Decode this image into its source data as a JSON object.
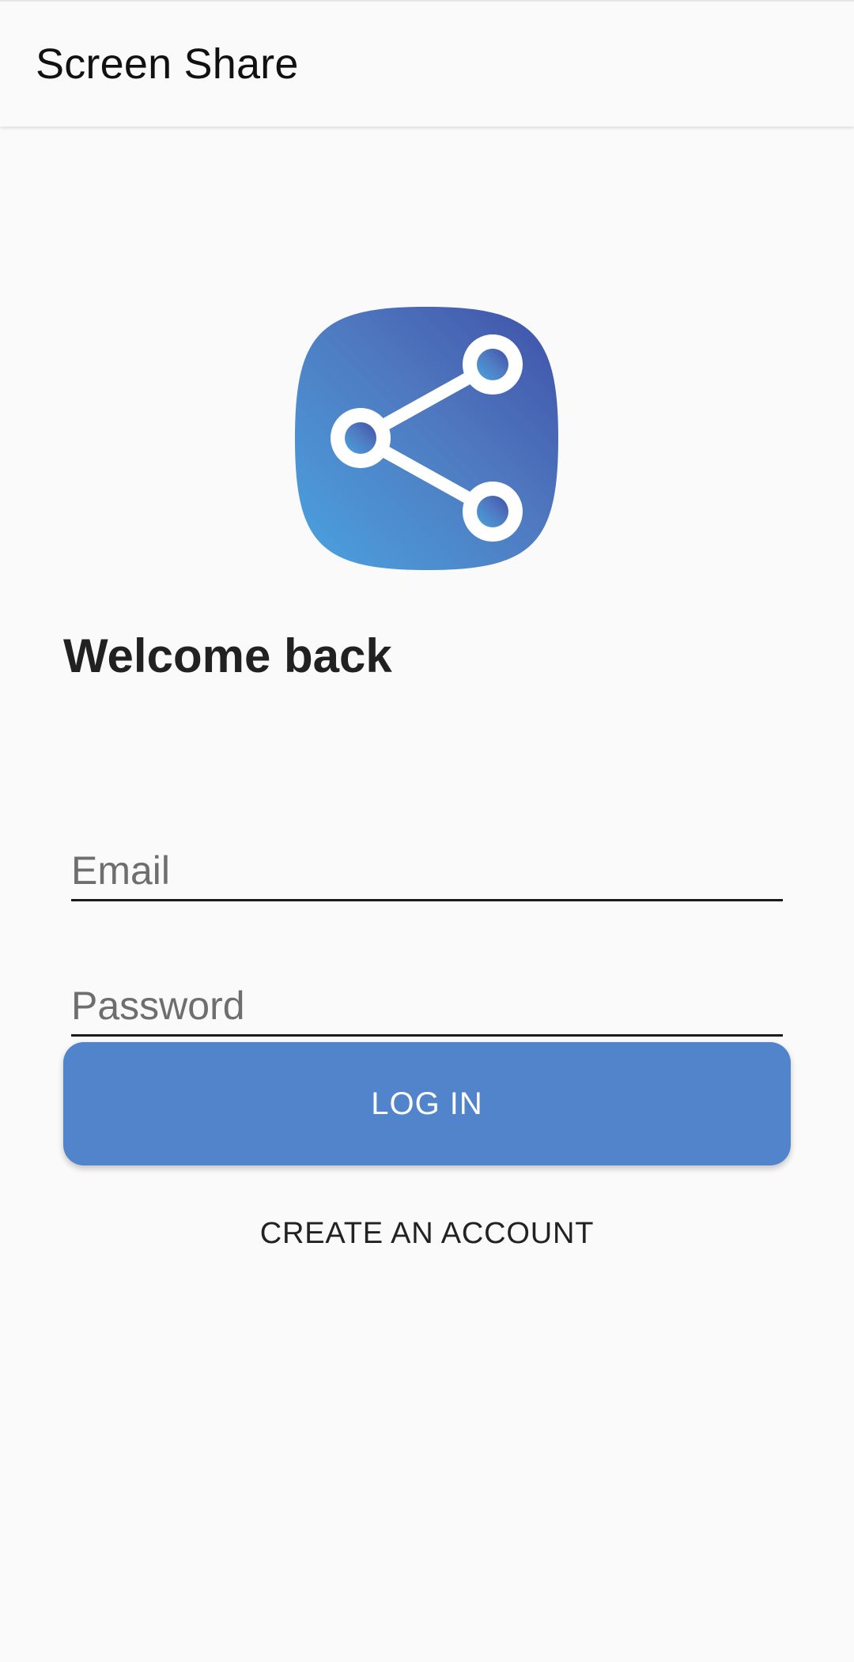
{
  "app_bar": {
    "title": "Screen Share"
  },
  "logo": {
    "icon": "share-icon",
    "gradient_start": "#4aa3e0",
    "gradient_end": "#3f51a8"
  },
  "login": {
    "heading": "Welcome back",
    "email_placeholder": "Email",
    "password_placeholder": "Password",
    "login_label": "LOG IN",
    "create_account_label": "CREATE AN ACCOUNT"
  },
  "colors": {
    "primary": "#5284cc",
    "background": "#fafafa",
    "text": "#212121"
  }
}
